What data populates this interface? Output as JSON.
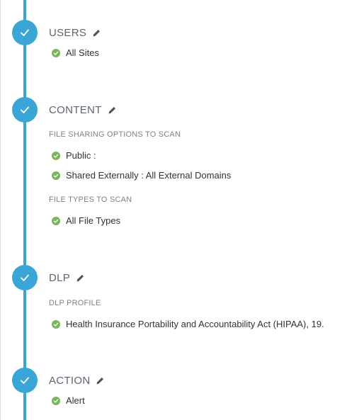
{
  "colors": {
    "timeline": "#3aa6d8",
    "check_green": "#7ab55c",
    "title_text": "#5d6670",
    "subheading_text": "#7b838b"
  },
  "steps": [
    {
      "title": "USERS",
      "icon": "check-icon",
      "edit_icon": "pencil-icon",
      "items": [
        "All Sites"
      ]
    },
    {
      "title": "CONTENT",
      "icon": "check-icon",
      "edit_icon": "pencil-icon",
      "sections": [
        {
          "heading": "FILE SHARING OPTIONS TO SCAN",
          "items": [
            "Public :",
            "Shared Externally : All External Domains"
          ]
        },
        {
          "heading": "FILE TYPES TO SCAN",
          "items": [
            "All File Types"
          ]
        }
      ]
    },
    {
      "title": "DLP",
      "icon": "check-icon",
      "edit_icon": "pencil-icon",
      "sections": [
        {
          "heading": "DLP PROFILE",
          "items": [
            "Health Insurance Portability and Accountability Act (HIPAA), 19."
          ]
        }
      ]
    },
    {
      "title": "ACTION",
      "icon": "check-icon",
      "edit_icon": "pencil-icon",
      "items": [
        "Alert"
      ]
    }
  ]
}
